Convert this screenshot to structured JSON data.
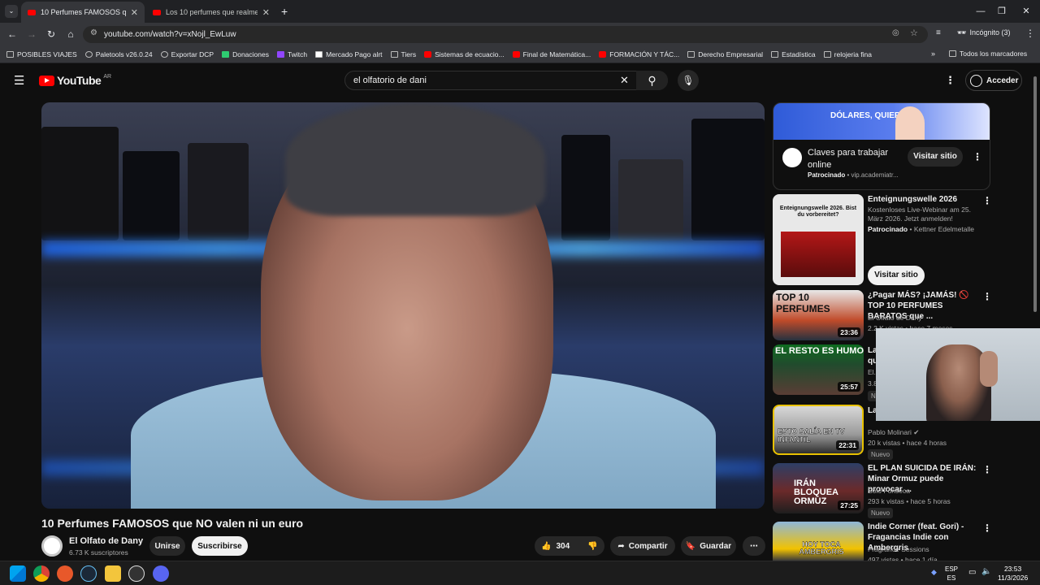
{
  "browser": {
    "tabs": [
      {
        "label": "10 Perfumes FAMOSOS que NO",
        "active": true
      },
      {
        "label": "Los 10 perfumes que realmente",
        "active": false
      }
    ],
    "url": "youtube.com/watch?v=xNojl_EwLuw",
    "profile": "Incógnito (3)",
    "bookmarks": [
      "POSIBLES VIAJES",
      "Paletools v26.0.24",
      "Exportar DCP",
      "Donaciones",
      "Twitch",
      "Mercado Pago alrt",
      "Tiers",
      "Sistemas de ecuacio...",
      "Final de Matemática...",
      "FORMACIÓN Y TÁC...",
      "Derecho Empresarial",
      "Estadística",
      "relojeria fina"
    ],
    "all_bookmarks": "Todos los marcadores"
  },
  "youtube": {
    "logo": "YouTube",
    "region": "AR",
    "search_value": "el olfatorio de dani",
    "login": "Acceder"
  },
  "video": {
    "title": "10 Perfumes FAMOSOS que NO valen ni un euro",
    "channel": "El Olfato de Dany",
    "subscribers": "6.73 K suscriptores",
    "join": "Unirse",
    "subscribe": "Suscribirse",
    "likes": "304",
    "share": "Compartir",
    "save": "Guardar"
  },
  "sidebar": {
    "ad1": {
      "banner_text": "DÓLARES, QUIERAS",
      "title": "Claves para trabajar online",
      "sponsored": "Patrocinado",
      "domain": "vip.academiatr...",
      "button": "Visitar sitio"
    },
    "ad2": {
      "thumb_text": "Enteignungswelle 2026. Bist du vorbereitet?",
      "title": "Enteignungswelle 2026",
      "description": "Kostenloses Live-Webinar am 25. März 2026. Jetzt anmelden!",
      "sponsored": "Patrocinado",
      "advertiser": "Kettner Edelmetalle",
      "button": "Visitar sitio"
    },
    "videos": [
      {
        "thumb_text": "TOP 10 PERFUMES",
        "title": "¿Pagar MÁS? ¡JAMÁS! 🚫 TOP 10 PERFUMES BARATOS que ...",
        "channel": "El Olfato de Dany",
        "meta": "2.2 K vistas • hace 7 meses",
        "duration": "23:36",
        "nuevo": ""
      },
      {
        "thumb_text": "EL RESTO ES HUMO",
        "title": "La... qu...",
        "channel": "El...",
        "meta": "3.8...",
        "duration": "25:57",
        "nuevo": "N"
      },
      {
        "thumb_text": "ESTO SALÍA EN TV INFANTIL",
        "title": "La... Picapiedra: origen, escándalos...",
        "channel": "Pablo Molinari ✔",
        "meta": "20 k vistas • hace 4 horas",
        "duration": "22:31",
        "nuevo": "Nuevo"
      },
      {
        "thumb_text": "IRÁN BLOQUEA ORMUZ",
        "title": "EL PLAN SUICIDA DE IRÁN: Minar Ormuz puede provocar ...",
        "channel": "Solo Fonseca",
        "meta": "293 k vistas • hace 5 horas",
        "duration": "27:25",
        "nuevo": "Nuevo"
      },
      {
        "thumb_text": "HOY TOCA AMBERGRIS",
        "title": "Indie Corner (feat. Gori) - Fragancias Indie con Ambergris",
        "channel": "Fragrance Sessions",
        "meta": "497 vistas • hace 1 día",
        "duration": "",
        "nuevo": ""
      }
    ]
  },
  "taskbar": {
    "lang": "ESP",
    "lang2": "ES",
    "time": "23:53",
    "date": "11/3/2026"
  },
  "colors": {
    "accent": "#ff0000",
    "bg": "#0f0f0f"
  }
}
